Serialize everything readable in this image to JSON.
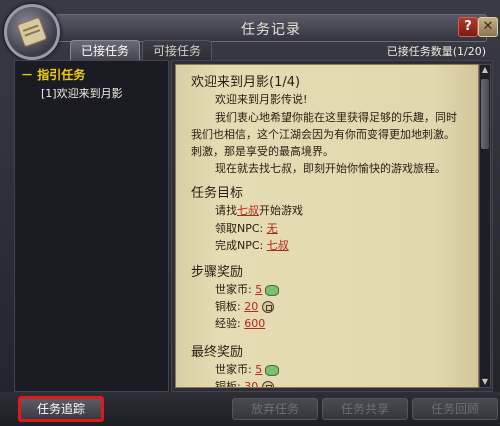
{
  "window": {
    "title": "任务记录"
  },
  "tabs": [
    {
      "label": "已接任务"
    },
    {
      "label": "可接任务"
    }
  ],
  "count_label": "已接任务数量(1/20)",
  "tree": {
    "category": "指引任务",
    "items": [
      {
        "label": "[1]欢迎来到月影"
      }
    ]
  },
  "quest": {
    "title": "欢迎来到月影(1/4)",
    "intro": [
      "欢迎来到月影传说!",
      "我们衷心地希望你能在这里获得足够的乐趣，同时",
      "我们也相信，这个江湖会因为有你而变得更加地刺激。",
      "刺激，那是享受的最高境界。",
      "现在就去找七叔，即刻开始你愉快的游戏旅程。"
    ],
    "goal_head": "任务目标",
    "goal_line1_pre": "请找",
    "goal_line1_npc": "七叔",
    "goal_line1_post": "开始游戏",
    "accept_label": "领取NPC: ",
    "accept_npc": "无",
    "finish_label": "完成NPC: ",
    "finish_npc": "七叔",
    "step_reward_head": "步骤奖励",
    "step_rewards": [
      {
        "label": "世家币: ",
        "value": "5",
        "icon": "coin-icon"
      },
      {
        "label": "铜板: ",
        "value": "20",
        "icon": "copper-icon"
      },
      {
        "label": "经验: ",
        "value": "600",
        "icon": ""
      }
    ],
    "final_reward_head": "最终奖励",
    "final_rewards": [
      {
        "label": "世家币: ",
        "value": "5",
        "icon": "coin-icon"
      },
      {
        "label": "铜板: ",
        "value": "30",
        "icon": "copper-icon"
      }
    ]
  },
  "buttons": {
    "track": "任务追踪",
    "abandon": "放弃任务",
    "share": "任务共享",
    "return": "任务回顾"
  }
}
